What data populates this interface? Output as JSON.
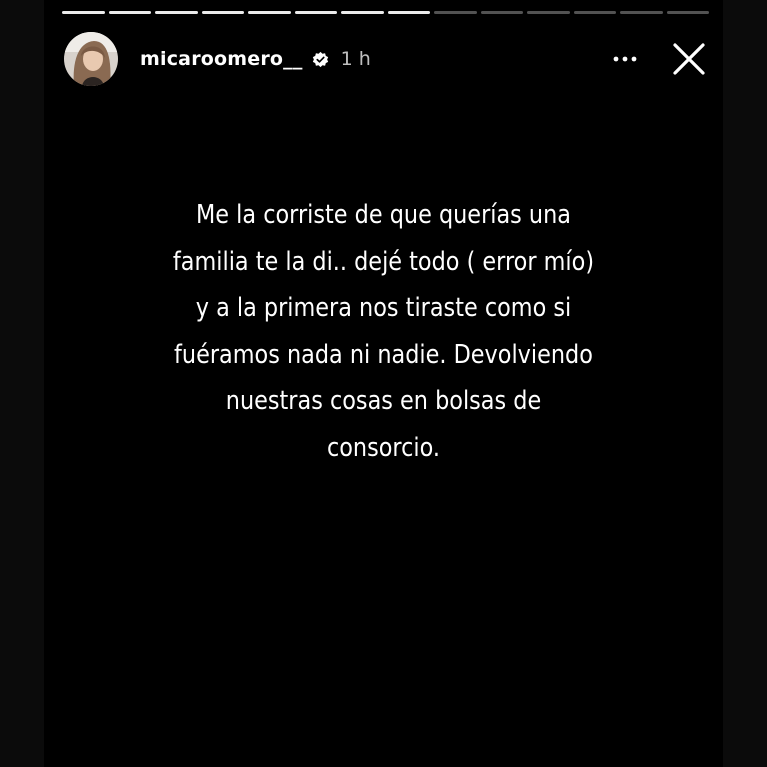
{
  "story": {
    "segments_total": 14,
    "segments_viewed": 8,
    "author": {
      "username": "micaroomero__",
      "verified": true,
      "posted": "1 h"
    },
    "caption_lines": [
      "Me la corriste de que querías una",
      "familia te la di.. dejé todo ( error mío)",
      "y a la primera nos tiraste como si",
      "fuéramos nada ni nadie. Devolviendo",
      "nuestras cosas en bolsas de",
      "consorcio."
    ],
    "icons": {
      "avatar": "profile-photo",
      "verified": "verified-badge-icon",
      "more": "more-options-icon",
      "close": "close-icon"
    },
    "colors": {
      "background": "#000000",
      "text": "#ffffff"
    }
  }
}
